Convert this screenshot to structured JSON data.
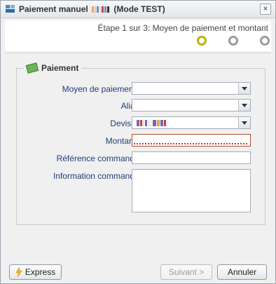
{
  "window": {
    "title_prefix": "Paiement manuel",
    "title_suffix": "(Mode TEST)",
    "close_label": "×"
  },
  "header": {
    "step_text": "Étape 1 sur 3: Moyen de paiement et montant",
    "steps": [
      {
        "state": "active",
        "color": "#b8b400"
      },
      {
        "state": "inactive",
        "color": "#9b9b9b"
      },
      {
        "state": "inactive",
        "color": "#9b9b9b"
      }
    ]
  },
  "form": {
    "legend": "Paiement",
    "fields": {
      "payment_method": {
        "label": "Moyen de paiement",
        "required_mark": "*",
        "value": ""
      },
      "alias": {
        "label": "Alias:",
        "value": ""
      },
      "currency": {
        "label": "Devise",
        "required_mark": "*",
        "value": ""
      },
      "amount": {
        "label": "Montant",
        "required_mark": "*",
        "value": ""
      },
      "order_reference": {
        "label": "Référence commande:",
        "value": ""
      },
      "order_information": {
        "label": "Information commande:",
        "value": ""
      }
    }
  },
  "footer": {
    "express_label": "Express",
    "next_label": "Suivant >",
    "cancel_label": "Annuler"
  },
  "colors": {
    "label": "#1f3d7a",
    "required": "#cc0000",
    "error_border": "#b24b2f",
    "active_step": "#b8b400"
  },
  "icons": {
    "title": "window-app-icon",
    "legend": "money-icon",
    "express": "lightning-icon"
  }
}
